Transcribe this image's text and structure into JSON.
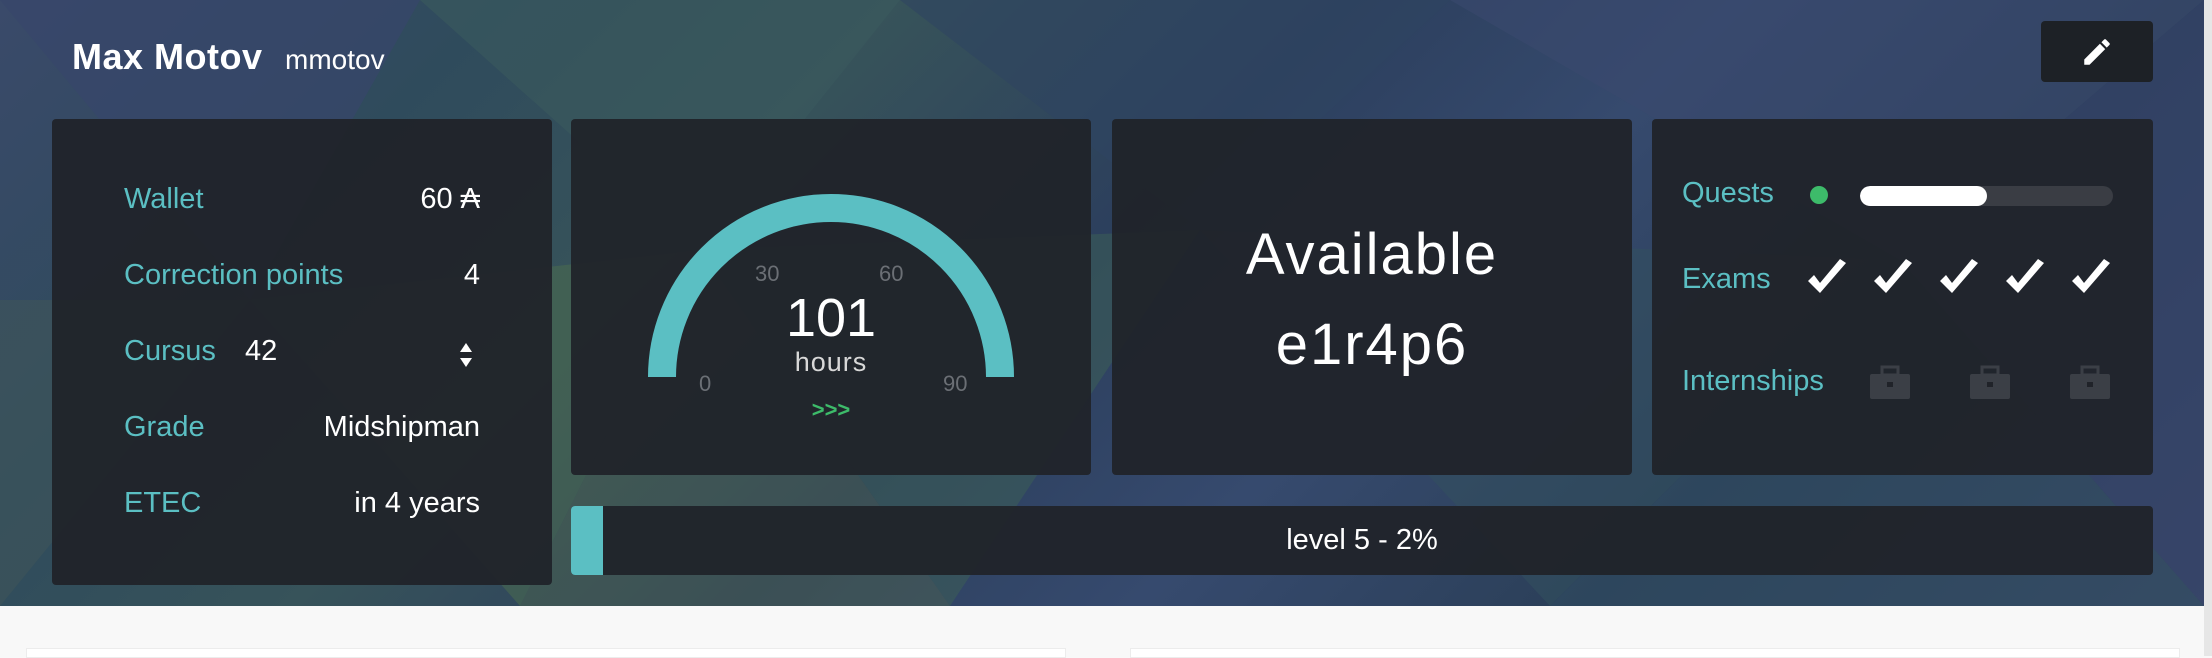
{
  "header": {
    "name": "Max Motov",
    "login": "mmotov",
    "edit_icon": "pencil-icon"
  },
  "stats": {
    "wallet_label": "Wallet",
    "wallet_value": "60 ₳",
    "correction_label": "Correction points",
    "correction_value": "4",
    "cursus_label": "Cursus",
    "cursus_value": "42",
    "grade_label": "Grade",
    "grade_value": "Midshipman",
    "etec_label": "ETEC",
    "etec_value": "in 4 years"
  },
  "gauge": {
    "value": "101",
    "unit": "hours",
    "more": ">>>",
    "ticks": [
      "0",
      "30",
      "60",
      "90"
    ],
    "fill_fraction": 1.0
  },
  "availability": {
    "status": "Available",
    "host": "e1r4p6"
  },
  "achievements": {
    "quests_label": "Quests",
    "quests_progress": 0.5,
    "exams_label": "Exams",
    "exams_passed": 5,
    "internships_label": "Internships",
    "internships_count": 3
  },
  "level": {
    "text": "level 5 - 2%",
    "progress": 0.02
  },
  "colors": {
    "accent": "#5bbfc3",
    "green_dot": "#3dbb6a",
    "panel": "#202329"
  }
}
